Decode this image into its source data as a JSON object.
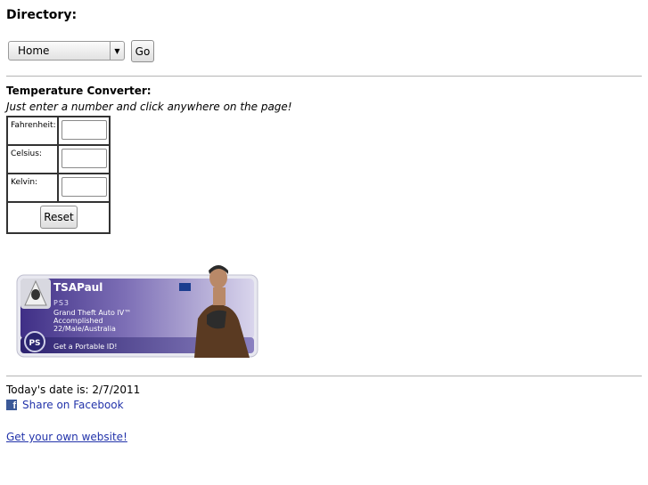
{
  "directory": {
    "heading": "Directory:",
    "select_value": "Home",
    "go_label": "Go"
  },
  "converter": {
    "heading": "Temperature Converter:",
    "instructions": "Just enter a number and click anywhere on the page!",
    "fahrenheit_label": "Fahrenheit:",
    "celsius_label": "Celsius:",
    "kelvin_label": "Kelvin:",
    "fahrenheit_value": "",
    "celsius_value": "",
    "kelvin_value": "",
    "reset_label": "Reset"
  },
  "psn_card": {
    "username": "TSAPaul",
    "platform": "PS3",
    "game": "Grand Theft Auto IV™",
    "status": "Accomplished",
    "profile": "22/Male/Australia",
    "cta": "Get a Portable ID!",
    "colors": {
      "panel": "#5b4a9a",
      "panel_light": "#c9c2e4",
      "border": "#e6e6ee"
    }
  },
  "footer": {
    "date_text": "Today's date is: 2/7/2011",
    "facebook_icon": "facebook-icon",
    "facebook_link": "Share on Facebook",
    "own_site_link": "Get your own website!"
  }
}
